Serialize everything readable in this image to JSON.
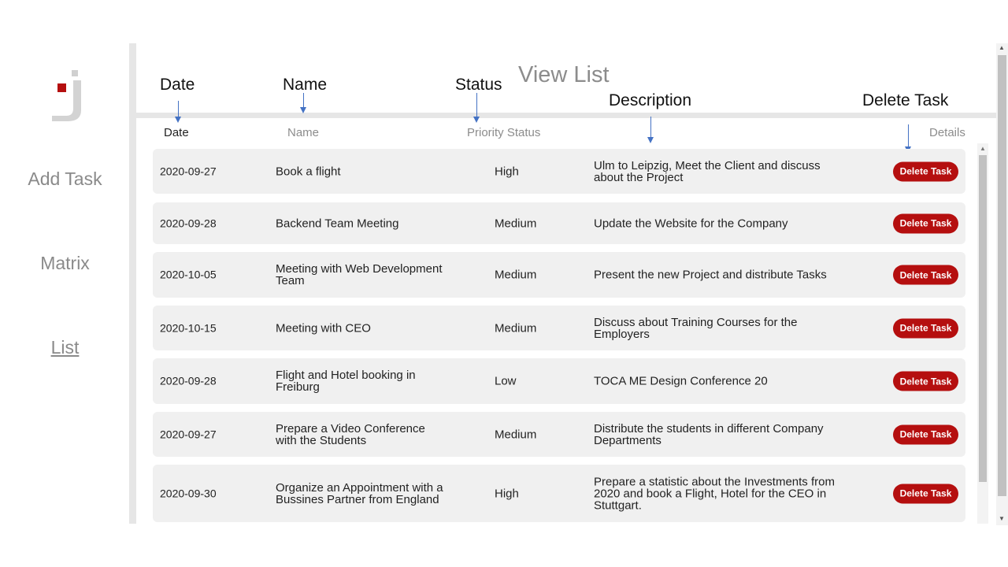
{
  "sidebar": {
    "items": [
      {
        "label": "Add Task"
      },
      {
        "label": "Matrix"
      },
      {
        "label": "List"
      }
    ],
    "active": "List"
  },
  "header": {
    "title": "View List",
    "columns": {
      "date": "Date",
      "name": "Name",
      "status": "Priority Status",
      "details": "Details"
    }
  },
  "annotations": {
    "date": "Date",
    "name": "Name",
    "status": "Status",
    "description": "Description",
    "delete": "Delete Task"
  },
  "tasks": [
    {
      "date": "2020-09-27",
      "name": "Book a flight",
      "priority": "High",
      "description": "Ulm to Leipzig, Meet the Client and discuss about the Project",
      "action": "Delete Task"
    },
    {
      "date": "2020-09-28",
      "name": "Backend Team Meeting",
      "priority": "Medium",
      "description": "Update the Website for the Company",
      "action": "Delete Task"
    },
    {
      "date": "2020-10-05",
      "name": "Meeting with Web Development Team",
      "priority": "Medium",
      "description": "Present the new Project and distribute Tasks",
      "action": "Delete Task"
    },
    {
      "date": "2020-10-15",
      "name": "Meeting with CEO",
      "priority": "Medium",
      "description": "Discuss about Training Courses for the Employers",
      "action": "Delete Task"
    },
    {
      "date": "2020-09-28",
      "name": "Flight and Hotel booking in Freiburg",
      "priority": "Low",
      "description": "TOCA ME Design Conference 20",
      "action": "Delete Task"
    },
    {
      "date": "2020-09-27",
      "name": "Prepare a Video Conference with the Students",
      "priority": "Medium",
      "description": "Distribute the students in different Company Departments",
      "action": "Delete Task"
    },
    {
      "date": "2020-09-30",
      "name": "Organize an Appointment with a Bussines Partner from England",
      "priority": "High",
      "description": "Prepare a statistic about the Investments from 2020 and book a Flight, Hotel for the CEO in Stuttgart.",
      "action": "Delete Task"
    }
  ],
  "colors": {
    "accent": "#b50f0f",
    "arrow": "#4472c4",
    "row_bg": "#f0f0f0",
    "muted_text": "#8c8c8c"
  }
}
